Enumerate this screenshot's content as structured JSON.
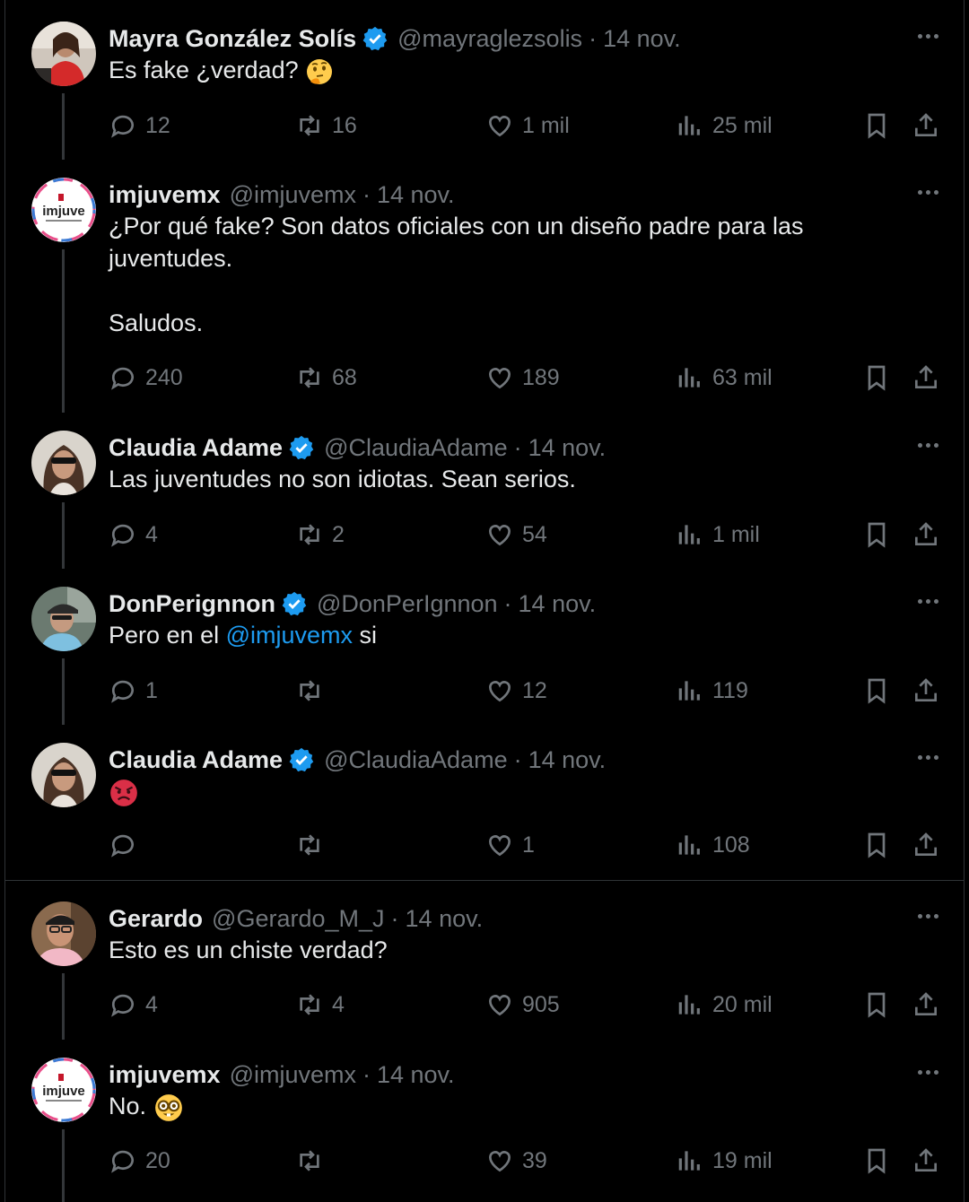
{
  "tweets": [
    {
      "name": "Mayra González Solís",
      "verified": true,
      "handle": "@mayraglezsolis",
      "date": "14 nov.",
      "text_parts": [
        "Es fake ¿verdad? "
      ],
      "emoji": "thinking-face",
      "replies": "12",
      "retweets": "16",
      "likes": "1 mil",
      "views": "25 mil",
      "avatar": "photo-woman-red"
    },
    {
      "name": "imjuvemx",
      "verified": false,
      "handle": "@imjuvemx",
      "date": "14 nov.",
      "text_parts": [
        "¿Por qué fake? Son datos oficiales con un diseño padre para las juventudes.\n\nSaludos."
      ],
      "replies": "240",
      "retweets": "68",
      "likes": "189",
      "views": "63 mil",
      "avatar": "imjuve-logo",
      "logo_text": "imjuve"
    },
    {
      "name": "Claudia Adame",
      "verified": true,
      "handle": "@ClaudiaAdame",
      "date": "14 nov.",
      "text_parts": [
        "Las juventudes no son idiotas. Sean serios."
      ],
      "replies": "4",
      "retweets": "2",
      "likes": "54",
      "views": "1 mil",
      "avatar": "photo-woman-sunglasses"
    },
    {
      "name": "DonPerignnon",
      "verified": true,
      "handle": "@DonPerIgnnon",
      "date": "14 nov.",
      "text_parts": [
        "Pero en el ",
        "@imjuvemx",
        " si"
      ],
      "replies": "1",
      "retweets": "",
      "likes": "12",
      "views": "119",
      "avatar": "photo-man-cap"
    },
    {
      "name": "Claudia Adame",
      "verified": true,
      "handle": "@ClaudiaAdame",
      "date": "14 nov.",
      "text_parts": [
        ""
      ],
      "emoji": "angry-face",
      "replies": "",
      "retweets": "",
      "likes": "1",
      "views": "108",
      "avatar": "photo-woman-sunglasses"
    },
    {
      "name": "Gerardo",
      "verified": false,
      "handle": "@Gerardo_M_J",
      "date": "14 nov.",
      "text_parts": [
        "Esto es un chiste verdad?"
      ],
      "replies": "4",
      "retweets": "4",
      "likes": "905",
      "views": "20 mil",
      "avatar": "photo-man-glasses"
    },
    {
      "name": "imjuvemx",
      "verified": false,
      "handle": "@imjuvemx",
      "date": "14 nov.",
      "text_parts": [
        "No. "
      ],
      "emoji": "nerd-face",
      "replies": "20",
      "retweets": "",
      "likes": "39",
      "views": "19 mil",
      "avatar": "imjuve-logo",
      "logo_text": "imjuve"
    }
  ],
  "colors": {
    "background": "#000000",
    "text": "#e7e9ea",
    "muted": "#71767b",
    "accent": "#1d9bf0",
    "divider": "#2f3336"
  }
}
